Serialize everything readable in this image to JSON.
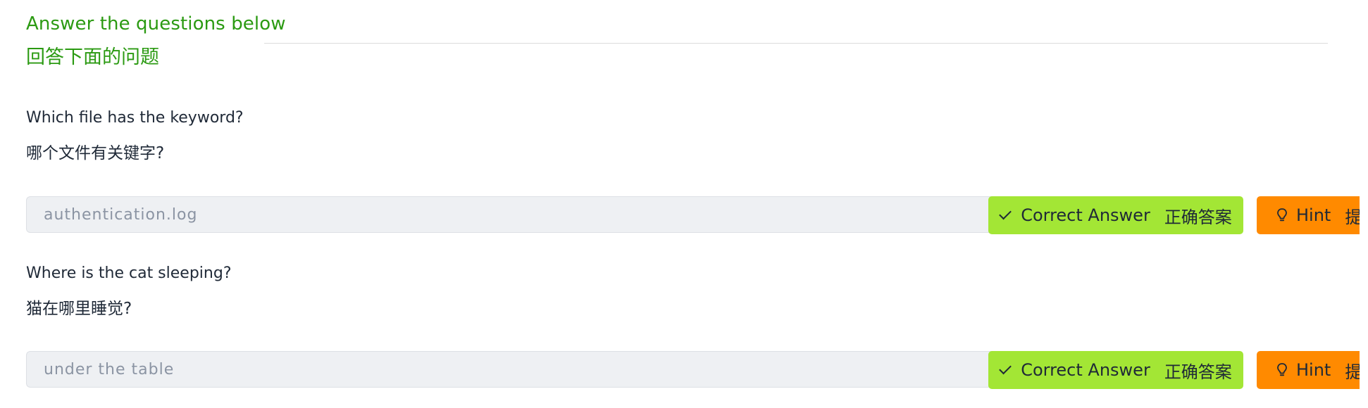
{
  "task": {
    "heading": "Answer the questions below",
    "heading_cn": "回答下面的问题"
  },
  "questions": [
    {
      "text": "Which file has the keyword?",
      "text_cn": "哪个文件有关键字?",
      "answer": "authentication.log",
      "correct_label": "Correct Answer",
      "correct_label_cn": "正确答案",
      "hint_label": "Hint",
      "hint_label_cn": "提"
    },
    {
      "text": "Where is the cat sleeping?",
      "text_cn": "猫在哪里睡觉?",
      "answer": "under the table",
      "correct_label": "Correct Answer",
      "correct_label_cn": "正确答案",
      "hint_label": "Hint",
      "hint_label_cn": "提"
    }
  ],
  "icons": {
    "correct": "check-icon",
    "hint": "lightbulb-icon"
  },
  "colors": {
    "heading": "#2b9a12",
    "correct_button": "#a3e635",
    "hint_button": "#ff8a00",
    "input_bg": "#eef0f3"
  }
}
